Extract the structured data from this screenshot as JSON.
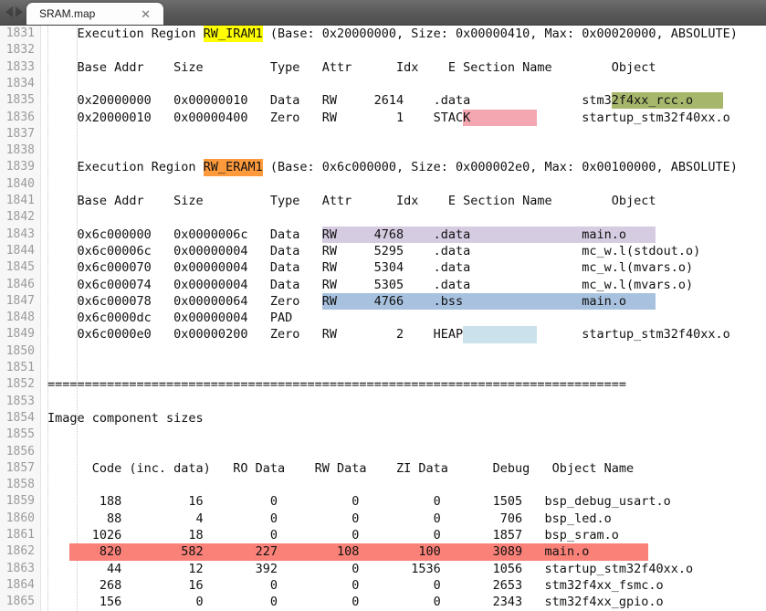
{
  "window": {
    "tabbar": {
      "nav_prev_icon": "chevron-left-icon",
      "nav_next_icon": "chevron-right-icon",
      "tabs": [
        {
          "title": "SRAM.map",
          "close_label": "✕",
          "active": true
        }
      ]
    }
  },
  "editor": {
    "first_line_number": 1831,
    "lines": [
      {
        "n": 1831,
        "text": "    Execution Region RW_IRAM1 (Base: 0x20000000, Size: 0x00000410, Max: 0x00020000, ABSOLUTE)"
      },
      {
        "n": 1832,
        "text": ""
      },
      {
        "n": 1833,
        "text": "    Base Addr    Size         Type   Attr      Idx    E Section Name        Object"
      },
      {
        "n": 1834,
        "text": ""
      },
      {
        "n": 1835,
        "text": "    0x20000000   0x00000010   Data   RW     2614    .data               stm32f4xx_rcc.o"
      },
      {
        "n": 1836,
        "text": "    0x20000010   0x00000400   Zero   RW        1    STACK               startup_stm32f40xx.o"
      },
      {
        "n": 1837,
        "text": ""
      },
      {
        "n": 1838,
        "text": ""
      },
      {
        "n": 1839,
        "text": "    Execution Region RW_ERAM1 (Base: 0x6c000000, Size: 0x000002e0, Max: 0x00100000, ABSOLUTE)"
      },
      {
        "n": 1840,
        "text": ""
      },
      {
        "n": 1841,
        "text": "    Base Addr    Size         Type   Attr      Idx    E Section Name        Object"
      },
      {
        "n": 1842,
        "text": ""
      },
      {
        "n": 1843,
        "text": "    0x6c000000   0x0000006c   Data   RW     4768    .data               main.o"
      },
      {
        "n": 1844,
        "text": "    0x6c00006c   0x00000004   Data   RW     5295    .data               mc_w.l(stdout.o)"
      },
      {
        "n": 1845,
        "text": "    0x6c000070   0x00000004   Data   RW     5304    .data               mc_w.l(mvars.o)"
      },
      {
        "n": 1846,
        "text": "    0x6c000074   0x00000004   Data   RW     5305    .data               mc_w.l(mvars.o)"
      },
      {
        "n": 1847,
        "text": "    0x6c000078   0x00000064   Zero   RW     4766    .bss                main.o"
      },
      {
        "n": 1848,
        "text": "    0x6c0000dc   0x00000004   PAD"
      },
      {
        "n": 1849,
        "text": "    0x6c0000e0   0x00000200   Zero   RW        2    HEAP                startup_stm32f40xx.o"
      },
      {
        "n": 1850,
        "text": ""
      },
      {
        "n": 1851,
        "text": ""
      },
      {
        "n": 1852,
        "text": "=============================================================================="
      },
      {
        "n": 1853,
        "text": ""
      },
      {
        "n": 1854,
        "text": "Image component sizes"
      },
      {
        "n": 1855,
        "text": ""
      },
      {
        "n": 1856,
        "text": ""
      },
      {
        "n": 1857,
        "text": "      Code (inc. data)   RO Data    RW Data    ZI Data      Debug   Object Name"
      },
      {
        "n": 1858,
        "text": ""
      },
      {
        "n": 1859,
        "text": "       188         16         0          0          0       1505   bsp_debug_usart.o"
      },
      {
        "n": 1860,
        "text": "        88          4         0          0          0        706   bsp_led.o"
      },
      {
        "n": 1861,
        "text": "      1026         18         0          0          0       1857   bsp_sram.o"
      },
      {
        "n": 1862,
        "text": "       820        582       227        108        100       3089   main.o"
      },
      {
        "n": 1863,
        "text": "        44         12       392          0       1536       1056   startup_stm32f40xx.o"
      },
      {
        "n": 1864,
        "text": "       268         16         0          0          0       2653   stm32f4xx_fsmc.o"
      },
      {
        "n": 1865,
        "text": "       156          0         0          0          0       2343   stm32f4xx_gpio.o"
      }
    ],
    "memory_regions": [
      {
        "name": "RW_IRAM1",
        "base": "0x20000000",
        "size": "0x00000410",
        "max": "0x00020000",
        "attribute": "ABSOLUTE",
        "columns": [
          "Base Addr",
          "Size",
          "Type",
          "Attr",
          "Idx",
          "E Section Name",
          "Object"
        ],
        "rows": [
          {
            "base_addr": "0x20000000",
            "size": "0x00000010",
            "type": "Data",
            "attr": "RW",
            "idx": "2614",
            "section": ".data",
            "object": "stm32f4xx_rcc.o"
          },
          {
            "base_addr": "0x20000010",
            "size": "0x00000400",
            "type": "Zero",
            "attr": "RW",
            "idx": "1",
            "section": "STACK",
            "object": "startup_stm32f40xx.o"
          }
        ]
      },
      {
        "name": "RW_ERAM1",
        "base": "0x6c000000",
        "size": "0x000002e0",
        "max": "0x00100000",
        "attribute": "ABSOLUTE",
        "columns": [
          "Base Addr",
          "Size",
          "Type",
          "Attr",
          "Idx",
          "E Section Name",
          "Object"
        ],
        "rows": [
          {
            "base_addr": "0x6c000000",
            "size": "0x0000006c",
            "type": "Data",
            "attr": "RW",
            "idx": "4768",
            "section": ".data",
            "object": "main.o"
          },
          {
            "base_addr": "0x6c00006c",
            "size": "0x00000004",
            "type": "Data",
            "attr": "RW",
            "idx": "5295",
            "section": ".data",
            "object": "mc_w.l(stdout.o)"
          },
          {
            "base_addr": "0x6c000070",
            "size": "0x00000004",
            "type": "Data",
            "attr": "RW",
            "idx": "5304",
            "section": ".data",
            "object": "mc_w.l(mvars.o)"
          },
          {
            "base_addr": "0x6c000074",
            "size": "0x00000004",
            "type": "Data",
            "attr": "RW",
            "idx": "5305",
            "section": ".data",
            "object": "mc_w.l(mvars.o)"
          },
          {
            "base_addr": "0x6c000078",
            "size": "0x00000064",
            "type": "Zero",
            "attr": "RW",
            "idx": "4766",
            "section": ".bss",
            "object": "main.o"
          },
          {
            "base_addr": "0x6c0000dc",
            "size": "0x00000004",
            "type": "PAD",
            "attr": "",
            "idx": "",
            "section": "",
            "object": ""
          },
          {
            "base_addr": "0x6c0000e0",
            "size": "0x00000200",
            "type": "Zero",
            "attr": "RW",
            "idx": "2",
            "section": "HEAP",
            "object": "startup_stm32f40xx.o"
          }
        ]
      }
    ],
    "image_component_sizes": {
      "heading": "Image component sizes",
      "columns": [
        "Code (inc. data)",
        "RO Data",
        "RW Data",
        "ZI Data",
        "Debug",
        "Object Name"
      ],
      "rows": [
        {
          "code": "188",
          "inc_data": "16",
          "ro_data": "0",
          "rw_data": "0",
          "zi_data": "0",
          "debug": "1505",
          "object": "bsp_debug_usart.o"
        },
        {
          "code": "88",
          "inc_data": "4",
          "ro_data": "0",
          "rw_data": "0",
          "zi_data": "0",
          "debug": "706",
          "object": "bsp_led.o"
        },
        {
          "code": "1026",
          "inc_data": "18",
          "ro_data": "0",
          "rw_data": "0",
          "zi_data": "0",
          "debug": "1857",
          "object": "bsp_sram.o"
        },
        {
          "code": "820",
          "inc_data": "582",
          "ro_data": "227",
          "rw_data": "108",
          "zi_data": "100",
          "debug": "3089",
          "object": "main.o"
        },
        {
          "code": "44",
          "inc_data": "12",
          "ro_data": "392",
          "rw_data": "0",
          "zi_data": "1536",
          "debug": "1056",
          "object": "startup_stm32f40xx.o"
        },
        {
          "code": "268",
          "inc_data": "16",
          "ro_data": "0",
          "rw_data": "0",
          "zi_data": "0",
          "debug": "2653",
          "object": "stm32f4xx_fsmc.o"
        },
        {
          "code": "156",
          "inc_data": "0",
          "ro_data": "0",
          "rw_data": "0",
          "zi_data": "0",
          "debug": "2343",
          "object": "stm32f4xx_gpio.o"
        }
      ]
    },
    "separator_line": "=============================================================================="
  },
  "highlights": {
    "yellow": "#ffff00",
    "orange": "#ff9a3c",
    "pink": "#f4a7b0",
    "olive": "#a6b76c",
    "lavender": "#d6cce2",
    "blue": "#a7c1de",
    "cyan": "#cbe2ec",
    "red": "#fa8178"
  }
}
